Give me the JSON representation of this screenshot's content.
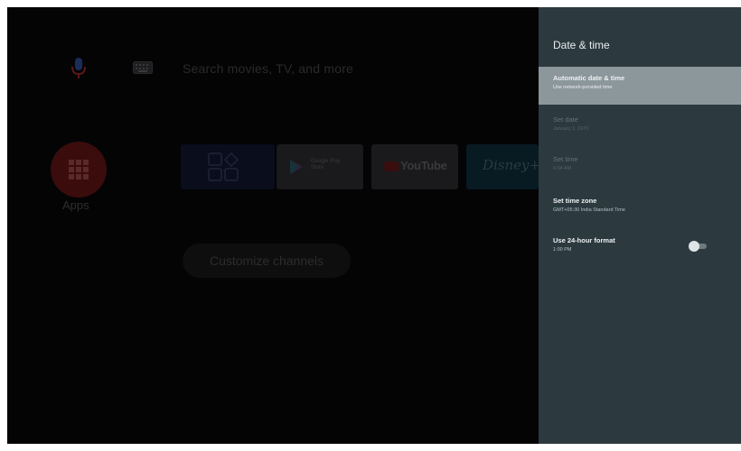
{
  "home": {
    "search_placeholder": "Search movies, TV, and more",
    "apps_label": "Apps",
    "tiles": {
      "play_store_text": "Google Play Store",
      "youtube_text": "YouTube",
      "disney_text": "Disney+"
    },
    "customize_label": "Customize channels"
  },
  "panel": {
    "title": "Date & time",
    "items": [
      {
        "title": "Automatic date & time",
        "subtitle": "Use network-provided time"
      },
      {
        "title": "Set date",
        "subtitle": "January 1, 1970"
      },
      {
        "title": "Set time",
        "subtitle": "6:04 AM"
      },
      {
        "title": "Set time zone",
        "subtitle": "GMT+05:30 India Standard Time"
      },
      {
        "title": "Use 24-hour format",
        "subtitle": "1:00 PM",
        "toggle": "off"
      }
    ]
  },
  "icons": {
    "mic": "microphone-icon",
    "keyboard": "keyboard-icon",
    "apps": "apps-grid-icon",
    "favorites": "favorites-icon",
    "play": "play-store-icon",
    "youtube": "youtube-logo-icon",
    "toggle": "toggle-switch-icon"
  },
  "colors": {
    "panel_bg": "#2c3a40",
    "focused_item": "#8c979c",
    "apps_red": "#3a0c0c",
    "home_bg": "#000000"
  }
}
